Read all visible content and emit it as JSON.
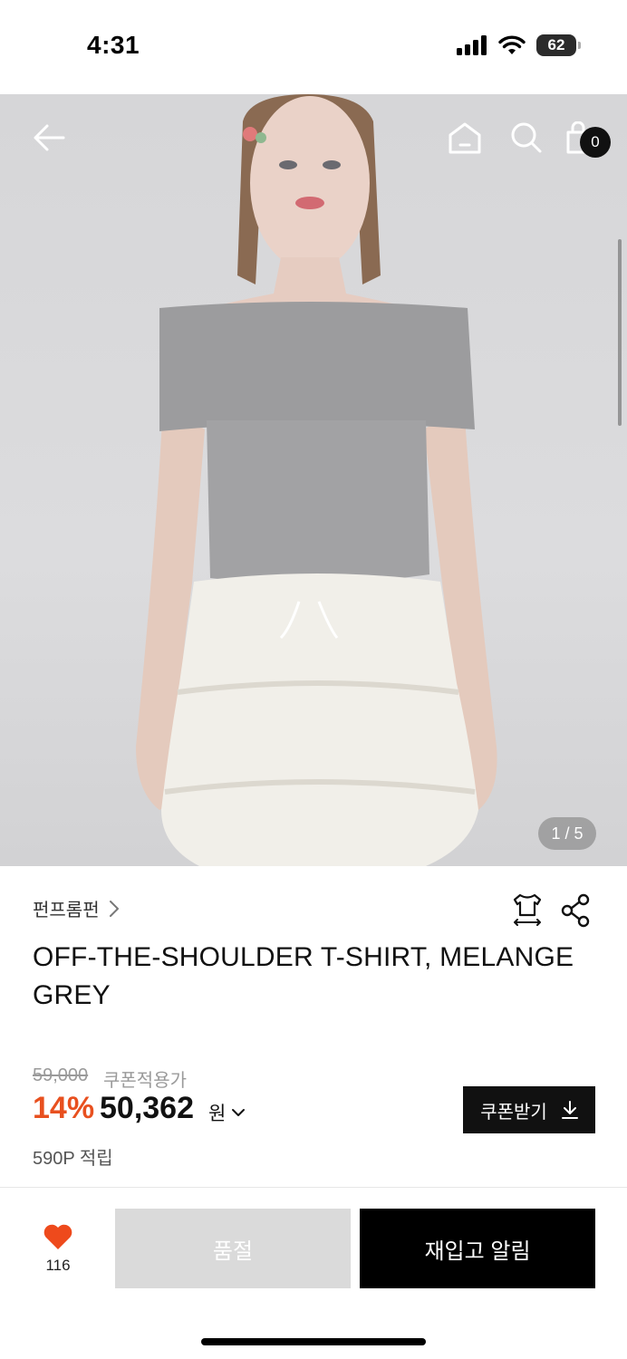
{
  "status_bar": {
    "time": "4:31",
    "battery": "62"
  },
  "hero": {
    "pager": "1 / 5",
    "cart_count": "0"
  },
  "product": {
    "brand": "펀프롬펀",
    "title": "OFF-THE-SHOULDER T-SHIRT, MELANGE GREY",
    "original_price": "59,000",
    "coupon_label": "쿠폰적용가",
    "discount": "14%",
    "price": "50,362",
    "currency": "원",
    "points": "590P 적립",
    "coupon_button": "쿠폰받기"
  },
  "bottom_bar": {
    "like_count": "116",
    "soldout_label": "품절",
    "restock_label": "재입고 알림"
  },
  "colors": {
    "accent": "#e8501f",
    "primary": "#000000",
    "disabled": "#dadada"
  },
  "icons": [
    "back-arrow-icon",
    "home-icon",
    "search-icon",
    "cart-icon",
    "size-guide-icon",
    "share-icon",
    "chevron-right-icon",
    "chevron-down-icon",
    "download-icon",
    "heart-icon"
  ]
}
